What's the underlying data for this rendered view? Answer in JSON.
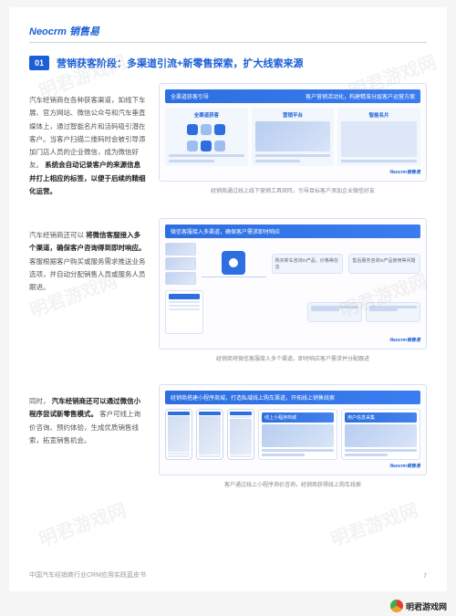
{
  "brand": "Neocrm 销售易",
  "section": {
    "num": "01",
    "title": "营销获客阶段：多渠道引流+新零售探索，扩大线索来源"
  },
  "row1": {
    "text_p1": "汽车经销商在各种获客渠道，如线下车展、官方网站、微信公众号和汽车垂直媒体上，通过智能名片和活码吸引潜在客户。当客户扫描二维码时会被引导添加门店人员的企业微信，成为微信好友。",
    "text_bold": "系统会自动记录客户的来源信息并打上相应的标签，以便于后续的精细化运营。",
    "fig_header_l": "全渠道获客引导",
    "fig_header_r": "客户营销活动化，构建精准分层客户运营方案",
    "panel1": "全渠道获客",
    "panel2": "营销平台",
    "panel3": "智能名片",
    "caption": "经销商通过线上线下营销工具矩阵，引导目标客户添加企业微信好友"
  },
  "row2": {
    "text_p1_a": "汽车经销商还可以",
    "text_p1_bold": "将微信客服接入多个渠道，确保客户咨询得到即时响应。",
    "text_p1_b": "客服根据客户购买或服务需求推送业务选项，并自动分配销售人员或服务人员跟进。",
    "fig_header": "微信客服接入多渠道，确保客户需求即时响应",
    "bubble1": "购买新车咨询\\n产品、价格等信息",
    "bubble2": "售后服务咨询\\n产品使用等问题",
    "caption": "经销商将微信客服接入多个渠道，即时响应客户需求并分配跟进"
  },
  "row3": {
    "text_a": "同时，",
    "text_bold": "汽车经销商还可以通过微信小程序尝试新零售模式。",
    "text_b": "客户可线上询价咨询、预约体验，生成优质销售线索，拓宽销售机会。",
    "fig_header": "经销商搭建小程序商城，打造私域线上购车渠道，开拓线上销售线索",
    "card3_h1": "线上小程序商城",
    "card3_h2": "用户信息采集",
    "caption": "客户通过线上小程序询价咨询，经销商获得线上购车线索"
  },
  "footer": "中国汽车经销商行业CRM应用实践蓝皮书",
  "page_num": "7",
  "fig_brand": "Neocrm销售易",
  "watermark_site": "明君游戏网"
}
